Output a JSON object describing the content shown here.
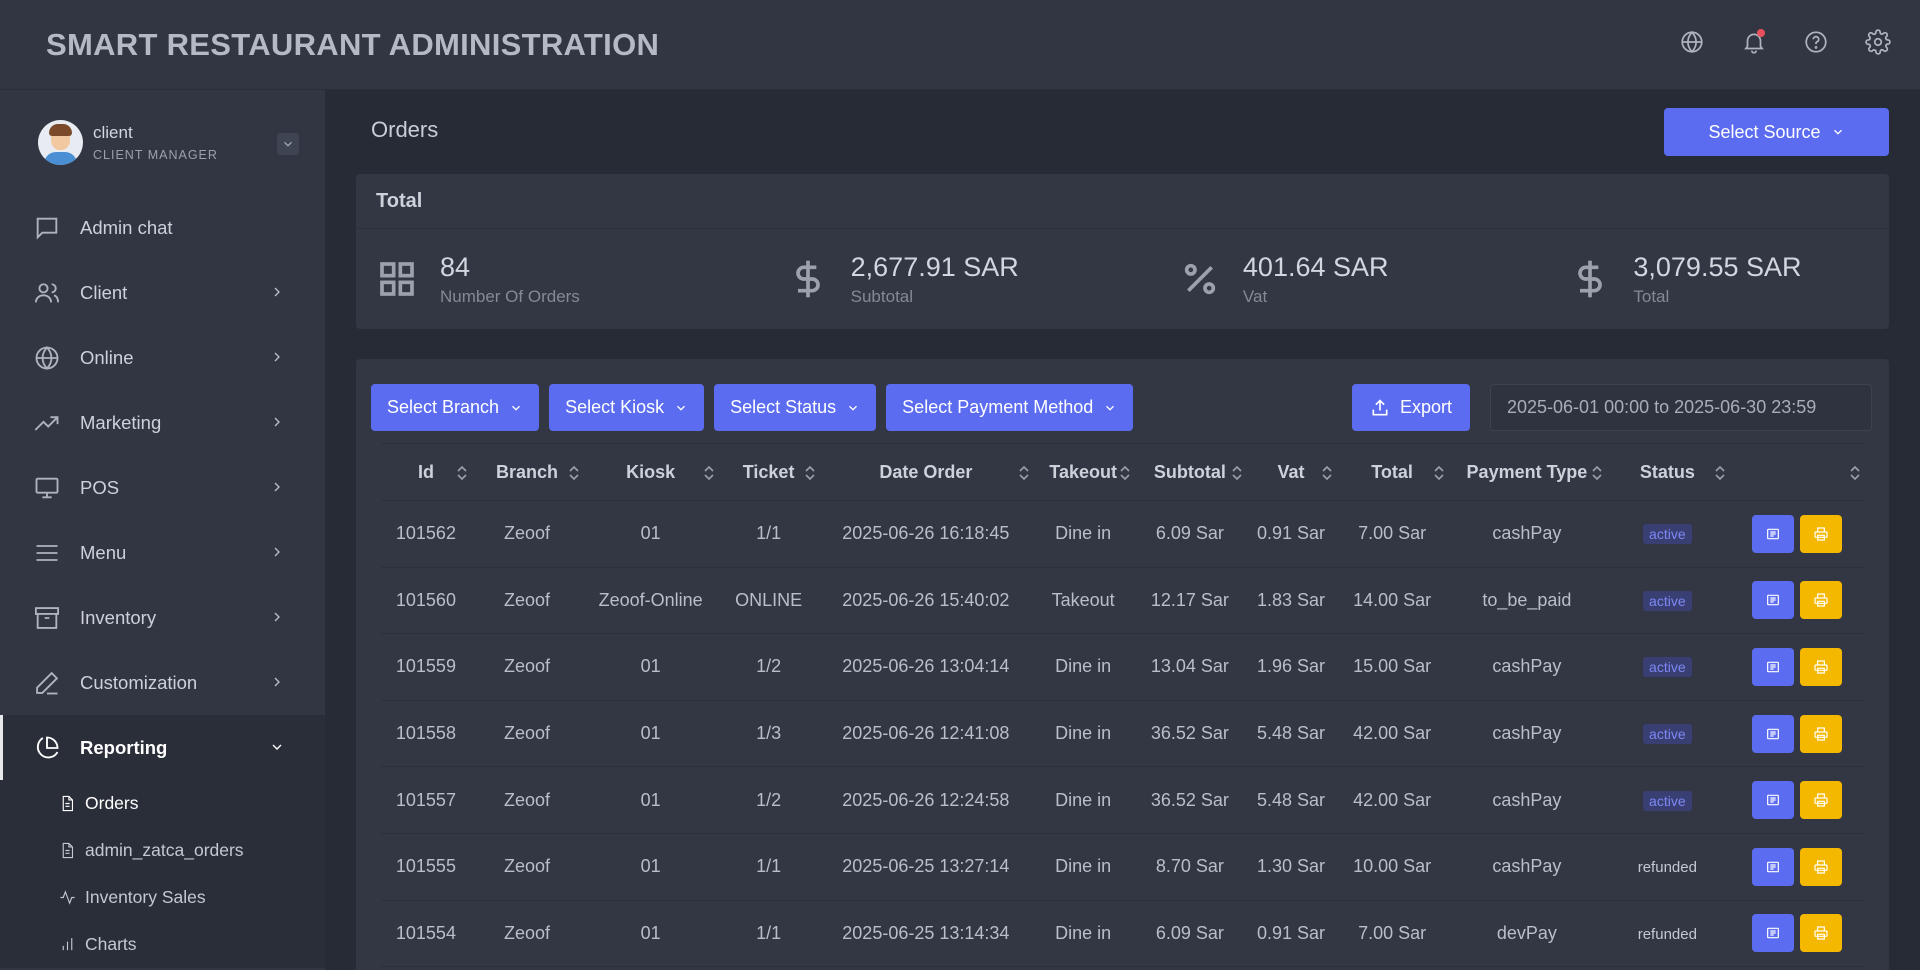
{
  "app": {
    "title": "SMART RESTAURANT ADMINISTRATION"
  },
  "header_icons": [
    "globe-icon",
    "bell-icon",
    "help-icon",
    "gear-icon"
  ],
  "profile": {
    "name": "client",
    "role": "CLIENT MANAGER"
  },
  "sidebar": {
    "items": [
      {
        "label": "Admin chat",
        "icon": "chat-icon"
      },
      {
        "label": "Client",
        "icon": "users-icon"
      },
      {
        "label": "Online",
        "icon": "globe-icon"
      },
      {
        "label": "Marketing",
        "icon": "trend-icon"
      },
      {
        "label": "POS",
        "icon": "monitor-icon"
      },
      {
        "label": "Menu",
        "icon": "menu-icon"
      },
      {
        "label": "Inventory",
        "icon": "archive-icon"
      },
      {
        "label": "Customization",
        "icon": "pen-icon"
      },
      {
        "label": "Reporting",
        "icon": "pie-chart-icon"
      }
    ],
    "sub_items": [
      {
        "label": "Orders",
        "icon": "file-icon"
      },
      {
        "label": "admin_zatca_orders",
        "icon": "file-icon"
      },
      {
        "label": "Inventory Sales",
        "icon": "activity-icon"
      },
      {
        "label": "Charts",
        "icon": "bar-chart-icon"
      }
    ]
  },
  "main": {
    "title": "Orders",
    "select_source": "Select Source"
  },
  "total": {
    "heading": "Total",
    "stats": [
      {
        "value": "84",
        "label": "Number Of Orders",
        "icon": "grid-icon"
      },
      {
        "value": "2,677.91 SAR",
        "label": "Subtotal",
        "icon": "dollar-icon"
      },
      {
        "value": "401.64 SAR",
        "label": "Vat",
        "icon": "percent-icon"
      },
      {
        "value": "3,079.55 SAR",
        "label": "Total",
        "icon": "dollar-icon"
      }
    ]
  },
  "filters": {
    "branch": "Select Branch",
    "kiosk": "Select Kiosk",
    "status": "Select Status",
    "payment": "Select Payment Method",
    "export": "Export",
    "date_range": "2025-06-01 00:00 to 2025-06-30 23:59"
  },
  "table": {
    "columns": [
      "Id",
      "Branch",
      "Kiosk",
      "Ticket",
      "Date Order",
      "Takeout",
      "Subtotal",
      "Vat",
      "Total",
      "Payment Type",
      "Status"
    ],
    "rows": [
      [
        "101562",
        "Zeoof",
        "01",
        "1/1",
        "2025-06-26 16:18:45",
        "Dine in",
        "6.09 Sar",
        "0.91 Sar",
        "7.00 Sar",
        "cashPay",
        "active"
      ],
      [
        "101560",
        "Zeoof",
        "Zeoof-Online",
        "ONLINE",
        "2025-06-26 15:40:02",
        "Takeout",
        "12.17 Sar",
        "1.83 Sar",
        "14.00 Sar",
        "to_be_paid",
        "active"
      ],
      [
        "101559",
        "Zeoof",
        "01",
        "1/2",
        "2025-06-26 13:04:14",
        "Dine in",
        "13.04 Sar",
        "1.96 Sar",
        "15.00 Sar",
        "cashPay",
        "active"
      ],
      [
        "101558",
        "Zeoof",
        "01",
        "1/3",
        "2025-06-26 12:41:08",
        "Dine in",
        "36.52 Sar",
        "5.48 Sar",
        "42.00 Sar",
        "cashPay",
        "active"
      ],
      [
        "101557",
        "Zeoof",
        "01",
        "1/2",
        "2025-06-26 12:24:58",
        "Dine in",
        "36.52 Sar",
        "5.48 Sar",
        "42.00 Sar",
        "cashPay",
        "active"
      ],
      [
        "101555",
        "Zeoof",
        "01",
        "1/1",
        "2025-06-25 13:27:14",
        "Dine in",
        "8.70 Sar",
        "1.30 Sar",
        "10.00 Sar",
        "cashPay",
        "refunded"
      ],
      [
        "101554",
        "Zeoof",
        "01",
        "1/1",
        "2025-06-25 13:14:34",
        "Dine in",
        "6.09 Sar",
        "0.91 Sar",
        "7.00 Sar",
        "devPay",
        "refunded"
      ]
    ]
  },
  "colors": {
    "primary": "#5b6cf0",
    "warning": "#f5b800",
    "notification": "#e8515b",
    "background": "#272b36",
    "panel": "#333744"
  }
}
